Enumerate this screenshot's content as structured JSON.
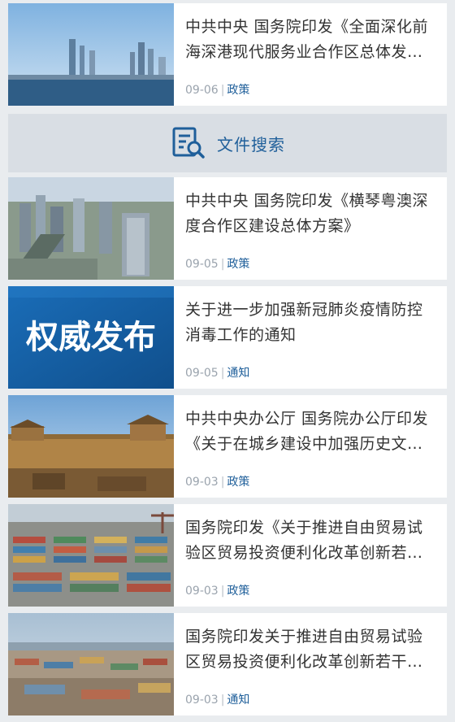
{
  "search": {
    "label": "文件搜索",
    "icon": "document-search-icon"
  },
  "articles": [
    {
      "title": "中共中央 国务院印发《全面深化前海深港现代服务业合作区总体发展规划》",
      "date": "09-06",
      "tag": "政策",
      "thumb": "city-skyline-photo"
    },
    {
      "title": "中共中央 国务院印发《横琴粤澳深度合作区建设总体方案》",
      "date": "09-05",
      "tag": "政策",
      "thumb": "aerial-city-photo"
    },
    {
      "title": "关于进一步加强新冠肺炎疫情防控消毒工作的通知",
      "date": "09-05",
      "tag": "通知",
      "thumb": "authoritative-release-banner",
      "banner_text": "权威发布"
    },
    {
      "title": "中共中央办公厅 国务院办公厅印发《关于在城乡建设中加强历史文化保护传承的意见》",
      "date": "09-03",
      "tag": "政策",
      "thumb": "ancient-city-wall-photo"
    },
    {
      "title": "国务院印发《关于推进自由贸易试验区贸易投资便利化改革创新若干措施》",
      "date": "09-03",
      "tag": "政策",
      "thumb": "container-port-photo"
    },
    {
      "title": "国务院印发关于推进自由贸易试验区贸易投资便利化改革创新若干措施的通知",
      "date": "09-03",
      "tag": "通知",
      "thumb": "aerial-port-photo"
    }
  ],
  "colors": {
    "accent": "#1f5f9a",
    "title": "#333333",
    "meta": "#9aa3ad",
    "banner": "#1762a8"
  }
}
